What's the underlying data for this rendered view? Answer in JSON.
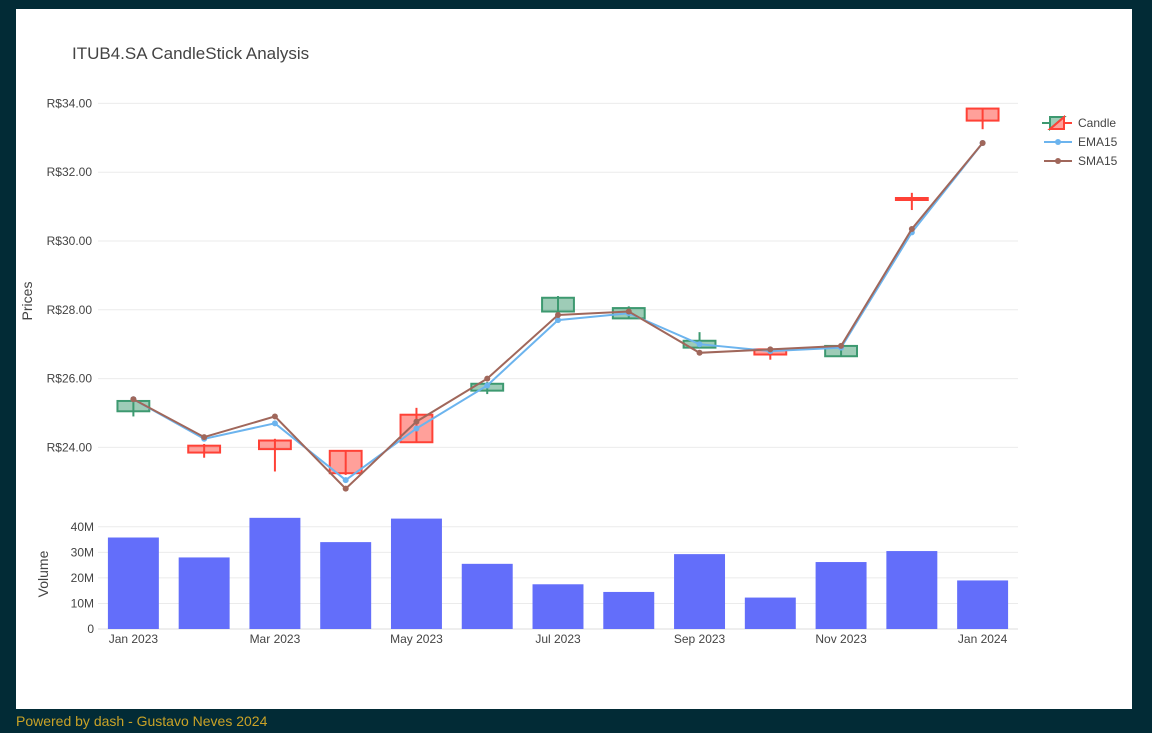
{
  "footer": {
    "text": "Powered by dash - Gustavo Neves 2024"
  },
  "chart_data": {
    "type": "candlestick",
    "title": "ITUB4.SA CandleStick Analysis",
    "price_axis": {
      "label": "Prices",
      "ylim": [
        22.5,
        35.0
      ],
      "ticks": [
        24,
        26,
        28,
        30,
        32,
        34
      ],
      "tick_labels": [
        "R$24.00",
        "R$26.00",
        "R$28.00",
        "R$30.00",
        "R$32.00",
        "R$34.00"
      ]
    },
    "volume_axis": {
      "label": "Volume",
      "ylim": [
        0,
        45000000
      ],
      "ticks": [
        0,
        10000000,
        20000000,
        30000000,
        40000000
      ],
      "tick_labels": [
        "0",
        "10M",
        "20M",
        "30M",
        "40M"
      ]
    },
    "x_ticks": [
      {
        "index": 0,
        "label": "Jan 2023"
      },
      {
        "index": 2,
        "label": "Mar 2023"
      },
      {
        "index": 4,
        "label": "May 2023"
      },
      {
        "index": 6,
        "label": "Jul 2023"
      },
      {
        "index": 8,
        "label": "Sep 2023"
      },
      {
        "index": 10,
        "label": "Nov 2023"
      },
      {
        "index": 12,
        "label": "Jan 2024"
      }
    ],
    "legend": {
      "placement": "top-right",
      "entries": [
        "Candle",
        "EMA15",
        "SMA15"
      ]
    },
    "colors": {
      "increasing": "#3d9970",
      "decreasing": "#ff4136",
      "ema": "#6cb4ee",
      "sma": "#a0675b",
      "volume": "#636efa",
      "grid": "#ebebeb",
      "text": "#444444"
    },
    "months": [
      "2023-01",
      "2023-02",
      "2023-03",
      "2023-04",
      "2023-05",
      "2023-06",
      "2023-07",
      "2023-08",
      "2023-09",
      "2023-10",
      "2023-11",
      "2023-12",
      "2024-01"
    ],
    "candles": [
      {
        "open": 25.05,
        "high": 25.4,
        "low": 24.9,
        "close": 25.35
      },
      {
        "open": 24.05,
        "high": 24.1,
        "low": 23.7,
        "close": 23.85
      },
      {
        "open": 24.2,
        "high": 24.25,
        "low": 23.3,
        "close": 23.95
      },
      {
        "open": 23.9,
        "high": 23.9,
        "low": 23.2,
        "close": 23.25
      },
      {
        "open": 24.95,
        "high": 25.15,
        "low": 24.15,
        "close": 24.15
      },
      {
        "open": 25.65,
        "high": 25.9,
        "low": 25.55,
        "close": 25.85
      },
      {
        "open": 27.95,
        "high": 28.4,
        "low": 27.95,
        "close": 28.35
      },
      {
        "open": 27.75,
        "high": 28.1,
        "low": 27.75,
        "close": 28.05
      },
      {
        "open": 26.9,
        "high": 27.35,
        "low": 26.9,
        "close": 27.1
      },
      {
        "open": 26.85,
        "high": 26.9,
        "low": 26.55,
        "close": 26.7
      },
      {
        "open": 26.65,
        "high": 26.95,
        "low": 26.65,
        "close": 26.95
      },
      {
        "open": 31.25,
        "high": 31.4,
        "low": 30.9,
        "close": 31.2
      },
      {
        "open": 33.85,
        "high": 33.85,
        "low": 33.25,
        "close": 33.5
      }
    ],
    "ema15": [
      25.4,
      24.25,
      24.7,
      23.05,
      24.55,
      25.8,
      27.7,
      27.9,
      27.0,
      26.8,
      26.9,
      30.25,
      32.85
    ],
    "sma15": [
      25.4,
      24.3,
      24.9,
      22.8,
      24.75,
      26.0,
      27.85,
      27.95,
      26.75,
      26.85,
      26.95,
      30.35,
      32.85
    ],
    "volume": [
      35800000,
      28000000,
      43500000,
      34000000,
      43200000,
      25500000,
      17500000,
      14500000,
      29300000,
      12300000,
      26200000,
      30500000,
      19000000
    ]
  }
}
